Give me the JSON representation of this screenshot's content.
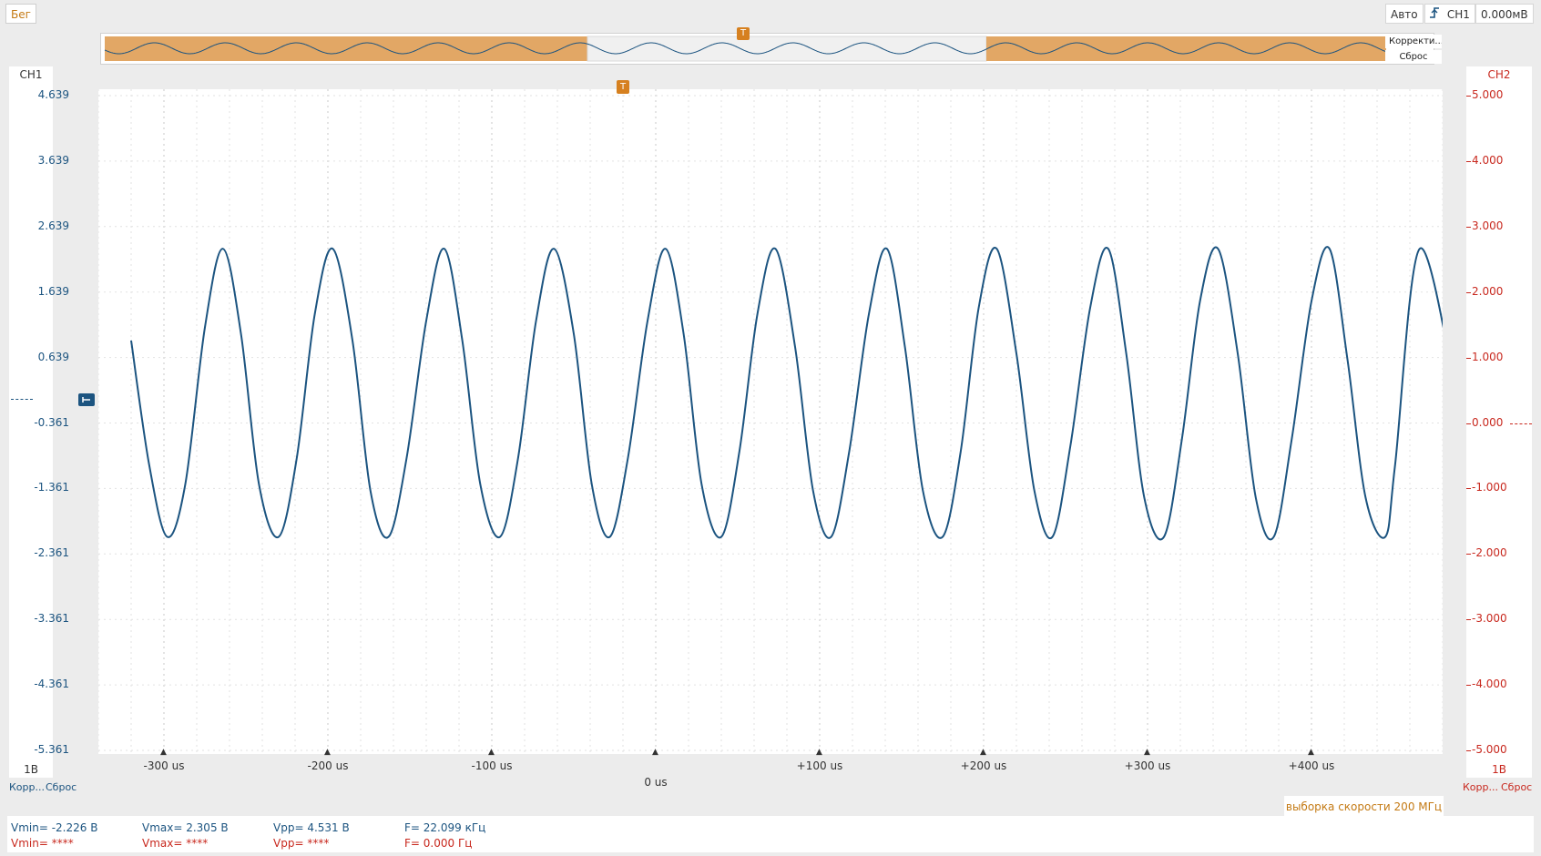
{
  "toolbar": {
    "run_label": "Бег",
    "trigger_mode": "Авто",
    "trigger_source": "CH1",
    "trigger_level": "0.000мВ"
  },
  "overview": {
    "correct_label": "Корректи...",
    "reset_label": "Сброс",
    "trigger_marker": "T"
  },
  "plot": {
    "trigger_marker": "T"
  },
  "ch1": {
    "label": "CH1",
    "scale": "1В",
    "correct_label": "Корр...",
    "reset_label": "Сброс",
    "color": "#1c5480",
    "ticks": [
      "4.639",
      "3.639",
      "2.639",
      "1.639",
      "0.639",
      "-0.361",
      "-1.361",
      "-2.361",
      "-3.361",
      "-4.361",
      "-5.361"
    ]
  },
  "ch2": {
    "label": "CH2",
    "scale": "1В",
    "correct_label": "Корр...",
    "reset_label": "Сброс",
    "color": "#c8281e",
    "ticks": [
      "5.000",
      "4.000",
      "3.000",
      "2.000",
      "1.000",
      "0.000",
      "-1.000",
      "-2.000",
      "-3.000",
      "-4.000",
      "-5.000"
    ]
  },
  "time_axis": {
    "labels": [
      "-300 us",
      "-200 us",
      "-100 us",
      "0 us",
      "+100 us",
      "+200 us",
      "+300 us",
      "+400 us"
    ]
  },
  "sample_rate": "выборка скорости 200 МГц",
  "measurements": {
    "ch1": {
      "vmin": "Vmin= -2.226 В",
      "vmax": "Vmax= 2.305 В",
      "vpp": "Vpp= 4.531 В",
      "freq": "F= 22.099 кГц"
    },
    "ch2": {
      "vmin": "Vmin= ****",
      "vmax": "Vmax= ****",
      "vpp": "Vpp= ****",
      "freq": "F= 0.000 Гц"
    }
  },
  "chart_data": {
    "type": "line",
    "series": [
      {
        "name": "CH1",
        "x": [
          -320,
          -309,
          -298,
          -287,
          -275,
          -264,
          -253,
          -242,
          -230,
          -219,
          -208,
          -197,
          -185,
          -174,
          -163,
          -152,
          -140,
          -129,
          -118,
          -107,
          -95,
          -84,
          -73,
          -62,
          -50,
          -39,
          -28,
          -17,
          -5,
          6,
          17,
          28,
          40,
          51,
          62,
          73,
          85,
          96,
          107,
          118,
          130,
          141,
          152,
          163,
          175,
          186,
          197,
          208,
          220,
          231,
          242,
          253,
          265,
          276,
          287,
          298,
          310,
          321,
          332,
          343,
          355,
          366,
          377,
          388,
          400,
          411,
          422,
          433,
          445,
          451,
          466,
          489
        ],
        "values": [
          0.9,
          -1.0,
          -2.1,
          -1.3,
          1.1,
          2.3,
          1.0,
          -1.3,
          -2.1,
          -0.9,
          1.3,
          2.3,
          0.9,
          -1.4,
          -2.1,
          -0.9,
          1.2,
          2.3,
          0.9,
          -1.3,
          -2.1,
          -0.9,
          1.2,
          2.3,
          1.0,
          -1.3,
          -2.1,
          -0.9,
          1.2,
          2.3,
          1.0,
          -1.3,
          -2.1,
          -0.8,
          1.3,
          2.3,
          0.8,
          -1.4,
          -2.1,
          -0.8,
          1.3,
          2.3,
          0.8,
          -1.4,
          -2.1,
          -0.8,
          1.4,
          2.3,
          0.7,
          -1.4,
          -2.1,
          -0.7,
          1.4,
          2.3,
          0.7,
          -1.5,
          -2.1,
          -0.6,
          1.5,
          2.3,
          0.7,
          -1.5,
          -2.1,
          -0.6,
          1.5,
          2.3,
          0.6,
          -1.5,
          -2.1,
          -1.0,
          2.3,
          0.0
        ]
      }
    ],
    "xlim": [
      -340,
      480
    ],
    "ylim": [
      -5.361,
      4.639
    ],
    "y2lim": [
      -5.0,
      5.0
    ],
    "xunit": "us",
    "grid": true
  }
}
